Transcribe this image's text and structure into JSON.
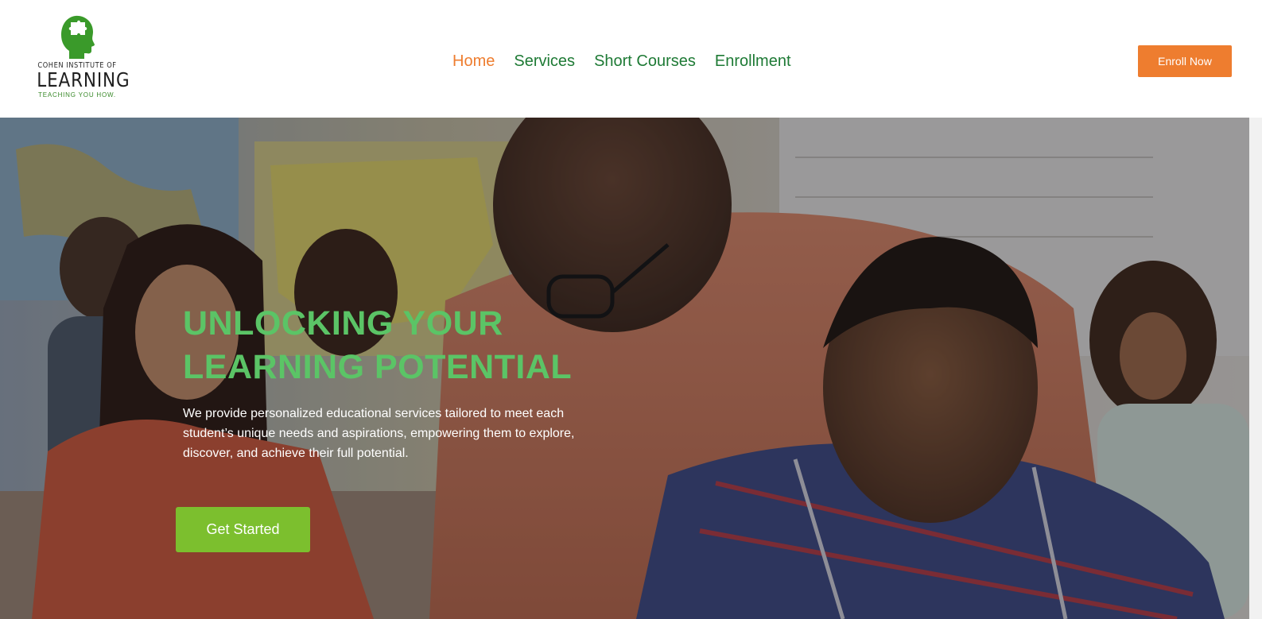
{
  "brand": {
    "line1": "COHEN INSTITUTE OF",
    "line2": "LEARNING",
    "tagline": "TEACHING YOU HOW.",
    "colors": {
      "green": "#3a9a2a",
      "dark": "#1f1f1f"
    }
  },
  "nav": {
    "items": [
      {
        "label": "Home",
        "active": true
      },
      {
        "label": "Services",
        "active": false
      },
      {
        "label": "Short Courses",
        "active": false
      },
      {
        "label": "Enrollment",
        "active": false
      }
    ]
  },
  "header": {
    "cta_label": "Enroll Now"
  },
  "hero": {
    "title_line1": "UNLOCKING YOUR",
    "title_line2": "LEARNING POTENTIAL",
    "description": "We provide personalized educational services tailored to meet each student’s unique needs and aspirations, empowering them to explore, discover, and achieve their full potential.",
    "cta_label": "Get Started"
  },
  "colors": {
    "accent_orange": "#ee7d2f",
    "nav_green": "#1e7a35",
    "title_green": "#5bc466",
    "button_green": "#7cbf2e"
  }
}
